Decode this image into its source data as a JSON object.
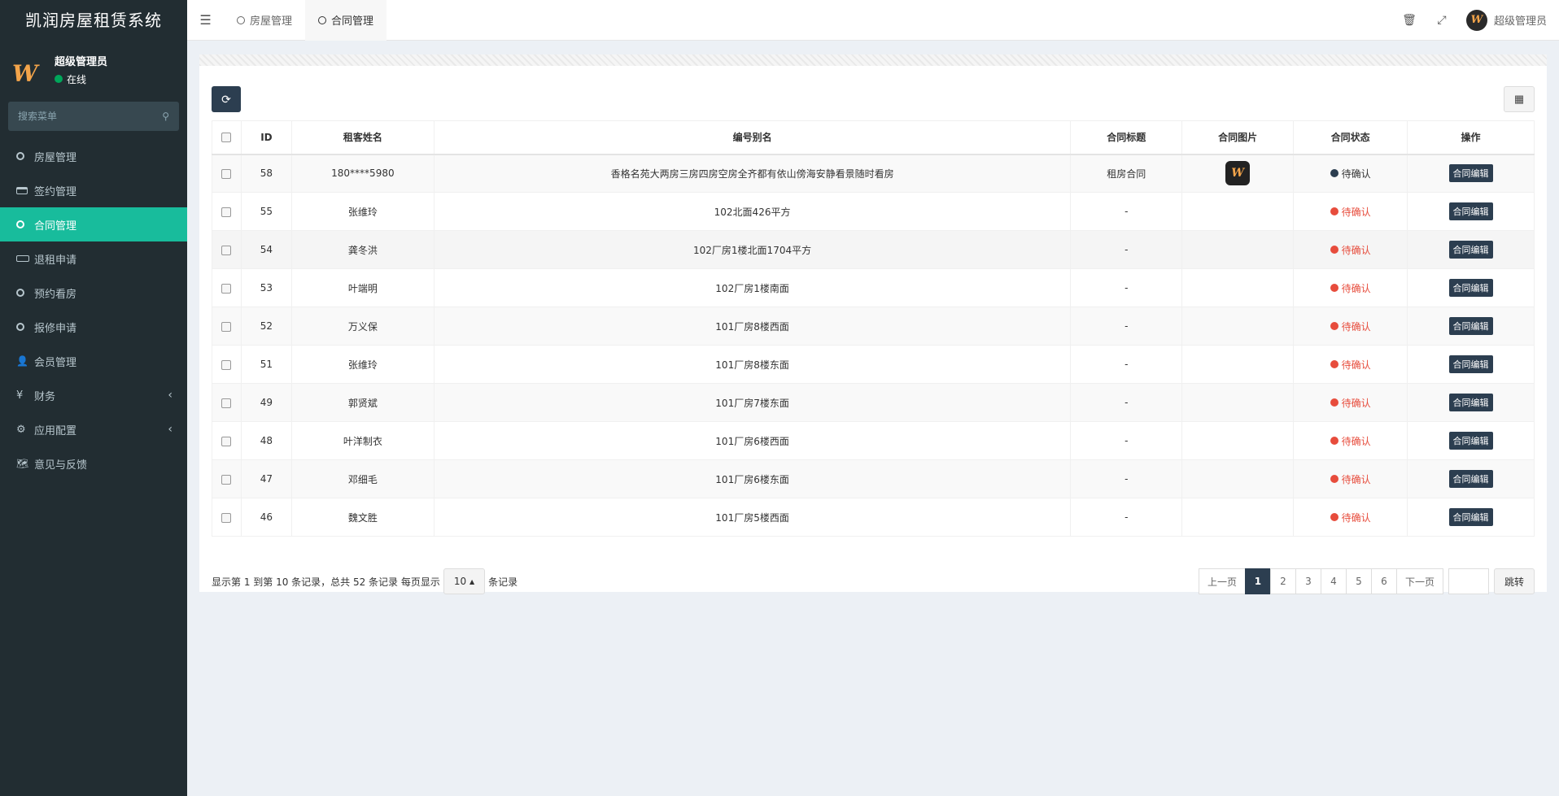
{
  "app": {
    "title": "凯润房屋租赁系统",
    "user_name": "超级管理员",
    "user_status": "在线",
    "search_placeholder": "搜索菜单"
  },
  "sidebar": {
    "items": [
      {
        "label": "房屋管理",
        "icon": "circle-icon"
      },
      {
        "label": "签约管理",
        "icon": "card-icon"
      },
      {
        "label": "合同管理",
        "icon": "circle-icon",
        "active": true
      },
      {
        "label": "退租申请",
        "icon": "rect-icon"
      },
      {
        "label": "预约看房",
        "icon": "circle-icon"
      },
      {
        "label": "报修申请",
        "icon": "circle-icon"
      },
      {
        "label": "会员管理",
        "icon": "user-icon"
      },
      {
        "label": "财务",
        "icon": "yen-icon",
        "has_children": true
      },
      {
        "label": "应用配置",
        "icon": "gears-icon",
        "has_children": true
      },
      {
        "label": "意见与反馈",
        "icon": "map-icon"
      }
    ]
  },
  "header": {
    "tabs": [
      {
        "label": "房屋管理"
      },
      {
        "label": "合同管理",
        "active": true
      }
    ],
    "user_name": "超级管理员"
  },
  "table": {
    "headers": [
      "ID",
      "租客姓名",
      "编号别名",
      "合同标题",
      "合同图片",
      "合同状态",
      "操作"
    ],
    "rows": [
      {
        "id": "58",
        "name": "180****5980",
        "alias": "香格名苑大两房三房四房空房全齐都有依山傍海安静看景随时看房",
        "title": "租房合同",
        "has_image": true,
        "status": "待确认",
        "status_color": "#2c3e50",
        "action": "合同编辑"
      },
      {
        "id": "55",
        "name": "张维玲",
        "alias": "102北面426平方",
        "title": "-",
        "has_image": false,
        "status": "待确认",
        "status_color": "#e74c3c",
        "action": "合同编辑"
      },
      {
        "id": "54",
        "name": "龚冬洪",
        "alias": "102厂房1楼北面1704平方",
        "title": "-",
        "has_image": false,
        "status": "待确认",
        "status_color": "#e74c3c",
        "action": "合同编辑"
      },
      {
        "id": "53",
        "name": "叶端明",
        "alias": "102厂房1楼南面",
        "title": "-",
        "has_image": false,
        "status": "待确认",
        "status_color": "#e74c3c",
        "action": "合同编辑"
      },
      {
        "id": "52",
        "name": "万义保",
        "alias": "101厂房8楼西面",
        "title": "-",
        "has_image": false,
        "status": "待确认",
        "status_color": "#e74c3c",
        "action": "合同编辑"
      },
      {
        "id": "51",
        "name": "张维玲",
        "alias": "101厂房8楼东面",
        "title": "-",
        "has_image": false,
        "status": "待确认",
        "status_color": "#e74c3c",
        "action": "合同编辑"
      },
      {
        "id": "49",
        "name": "郭贤斌",
        "alias": "101厂房7楼东面",
        "title": "-",
        "has_image": false,
        "status": "待确认",
        "status_color": "#e74c3c",
        "action": "合同编辑"
      },
      {
        "id": "48",
        "name": "叶洋制衣",
        "alias": "101厂房6楼西面",
        "title": "-",
        "has_image": false,
        "status": "待确认",
        "status_color": "#e74c3c",
        "action": "合同编辑"
      },
      {
        "id": "47",
        "name": "邓细毛",
        "alias": "101厂房6楼东面",
        "title": "-",
        "has_image": false,
        "status": "待确认",
        "status_color": "#e74c3c",
        "action": "合同编辑"
      },
      {
        "id": "46",
        "name": "魏文胜",
        "alias": "101厂房5楼西面",
        "title": "-",
        "has_image": false,
        "status": "待确认",
        "status_color": "#e74c3c",
        "action": "合同编辑"
      }
    ]
  },
  "pagination": {
    "info_prefix": "显示第 1 到第 10 条记录，总共 52 条记录 每页显示",
    "page_size": "10",
    "info_suffix": "条记录",
    "prev": "上一页",
    "next": "下一页",
    "pages": [
      "1",
      "2",
      "3",
      "4",
      "5",
      "6"
    ],
    "current": "1",
    "jump": "跳转"
  },
  "colors": {
    "sidebar_bg": "#222d32",
    "active_green": "#18bc9c",
    "primary_dark": "#2c3e50",
    "status_red": "#e74c3c"
  }
}
